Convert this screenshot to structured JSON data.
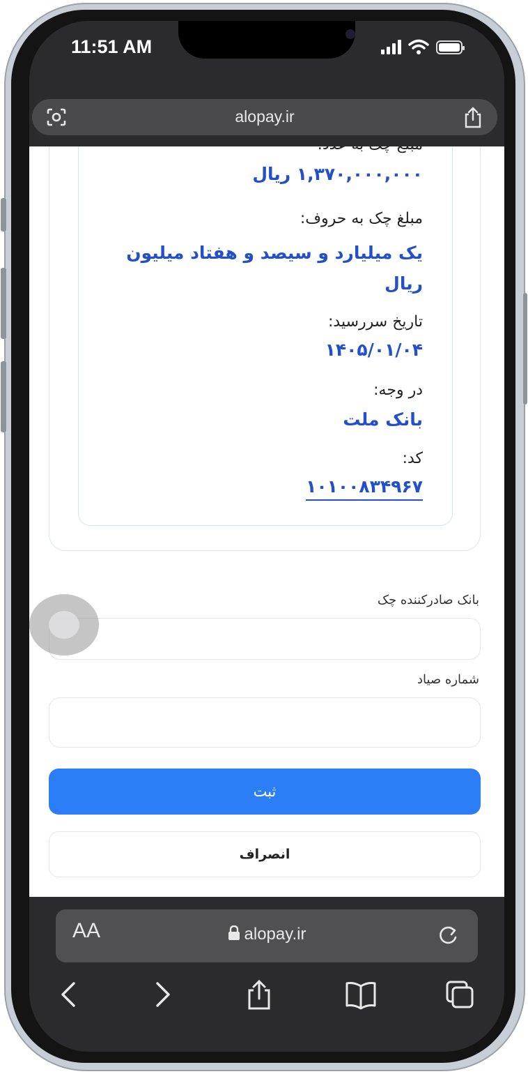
{
  "status_bar": {
    "time": "11:51 AM"
  },
  "browser": {
    "top_url": "alopay.ir",
    "bottom_url": "alopay.ir",
    "text_size_label": "AA"
  },
  "cheque": {
    "amount_numeric_label": "مبلغ چک به عدد:",
    "amount_numeric_value": "۱,۳۷۰,۰۰۰,۰۰۰ ریال",
    "amount_words_label": "مبلغ چک به حروف:",
    "amount_words_value": "یک میلیارد و سیصد و هفتاد میلیون ریال",
    "due_date_label": "تاریخ سررسید:",
    "due_date_value": "۱۴۰۵/۰۱/۰۴",
    "payee_label": "در وجه:",
    "payee_value": "بانک ملت",
    "code_label": "کد:",
    "code_value": "۱۰۱۰۰۸۳۴۹۶۷"
  },
  "form": {
    "issuing_bank_label": "بانک صادرکننده چک",
    "issuing_bank_value": "",
    "sayad_label": "شماره صیاد",
    "sayad_value": "",
    "submit_label": "ثبت",
    "cancel_label": "انصراف"
  },
  "colors": {
    "accent": "#2b7ef6",
    "value_text": "#2350c8"
  }
}
